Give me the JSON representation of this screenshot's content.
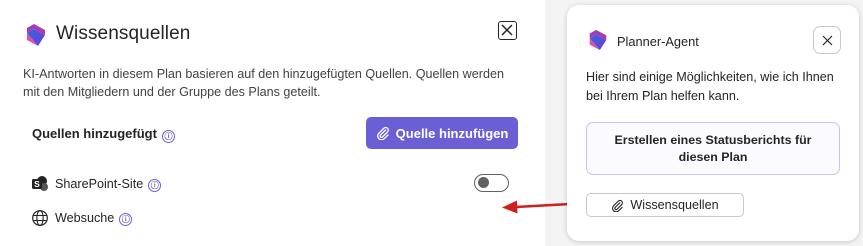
{
  "dialog": {
    "title": "Wissensquellen",
    "description": "KI-Antworten in diesem Plan basieren auf den hinzugefügten Quellen. Quellen werden mit den Mitgliedern und der Gruppe des Plans geteilt.",
    "sources_label": "Quellen hinzugefügt",
    "add_button_label": "Quelle hinzufügen",
    "sources": [
      {
        "label": "SharePoint-Site",
        "icon": "sharepoint-icon",
        "toggle_on": false
      },
      {
        "label": "Websuche",
        "icon": "globe-icon"
      }
    ]
  },
  "agent_panel": {
    "title": "Planner-Agent",
    "message": "Hier sind einige Möglichkeiten, wie ich Ihnen bei Ihrem Plan helfen kann.",
    "suggestion_label": "Erstellen eines Statusberichts für diesen Plan",
    "knowledge_button_label": "Wissensquellen"
  },
  "icons": {
    "info": "ⓘ",
    "close": "close-icon",
    "attach": "paperclip-icon",
    "logo": "planner-logo"
  },
  "colors": {
    "accent": "#6b5fd6",
    "annotation_arrow": "#d01f1f",
    "toggle_off": "#616161"
  }
}
